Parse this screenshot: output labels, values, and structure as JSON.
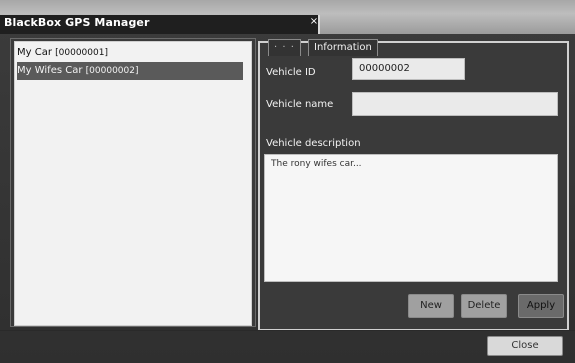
{
  "window": {
    "title": "BlackBox GPS Manager",
    "close_symbol": "×"
  },
  "vehicles": {
    "items": [
      {
        "name": "My Car",
        "id": "[00000001]"
      },
      {
        "name": "My Wifes Car",
        "id": "[00000002]"
      }
    ],
    "selected_index": 1
  },
  "info_panel": {
    "tab_label": "Information",
    "vehicle_id_label": "Vehicle ID",
    "vehicle_id_value": "00000002",
    "vehicle_name_label": "Vehicle name",
    "vehicle_name_value": "",
    "vehicle_description_label": "Vehicle description",
    "vehicle_description_value": "The rony wifes car..."
  },
  "buttons": {
    "new": "New",
    "delete": "Delete",
    "apply": "Apply",
    "close": "Close"
  }
}
